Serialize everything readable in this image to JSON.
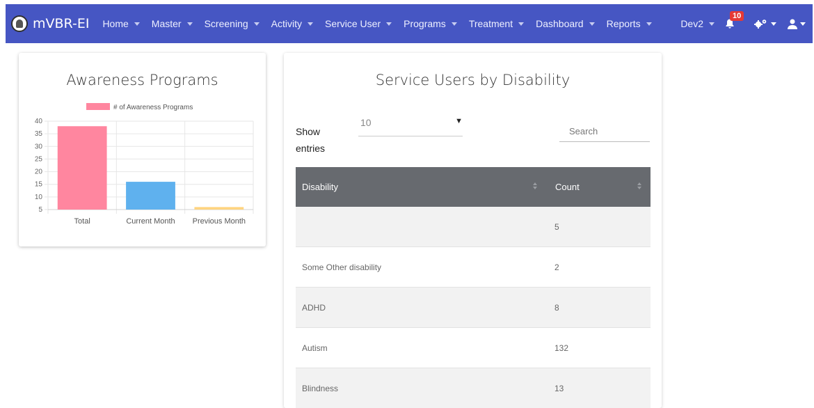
{
  "navbar": {
    "brand": "mVBR-EI",
    "logo_icon": "org-seal-icon",
    "menu": [
      {
        "label": "Home"
      },
      {
        "label": "Master"
      },
      {
        "label": "Screening"
      },
      {
        "label": "Activity"
      },
      {
        "label": "Service User"
      },
      {
        "label": "Programs"
      },
      {
        "label": "Treatment"
      },
      {
        "label": "Dashboard"
      },
      {
        "label": "Reports"
      }
    ],
    "user_menu": "Dev2",
    "notification_count": "10",
    "color": "#4656c3"
  },
  "awareness_card": {
    "title": "Awareness Programs"
  },
  "chart_data": {
    "type": "bar",
    "title": "",
    "legend": [
      "# of Awareness Programs"
    ],
    "categories": [
      "Total",
      "Current Month",
      "Previous Month"
    ],
    "series": [
      {
        "name": "# of Awareness Programs",
        "values": [
          38,
          16,
          6
        ]
      }
    ],
    "bar_colors": [
      "#ff869f",
      "#5fb1ee",
      "#ffd480"
    ],
    "ylim": [
      5,
      40
    ],
    "yticks": [
      "40",
      "35",
      "30",
      "25",
      "20",
      "15",
      "10",
      "5"
    ],
    "legend_position": "top",
    "grid": true
  },
  "disability_card": {
    "title": "Service Users by Disability",
    "show_label": "Show entries",
    "page_size": "10",
    "search_placeholder": "Search",
    "columns": [
      "Disability",
      "Count"
    ],
    "rows": [
      {
        "disability": "",
        "count": "5"
      },
      {
        "disability": "Some Other disability",
        "count": "2"
      },
      {
        "disability": "ADHD",
        "count": "8"
      },
      {
        "disability": "Autism",
        "count": "132"
      },
      {
        "disability": "Blindness",
        "count": "13"
      }
    ],
    "header_color": "#676a6f"
  }
}
